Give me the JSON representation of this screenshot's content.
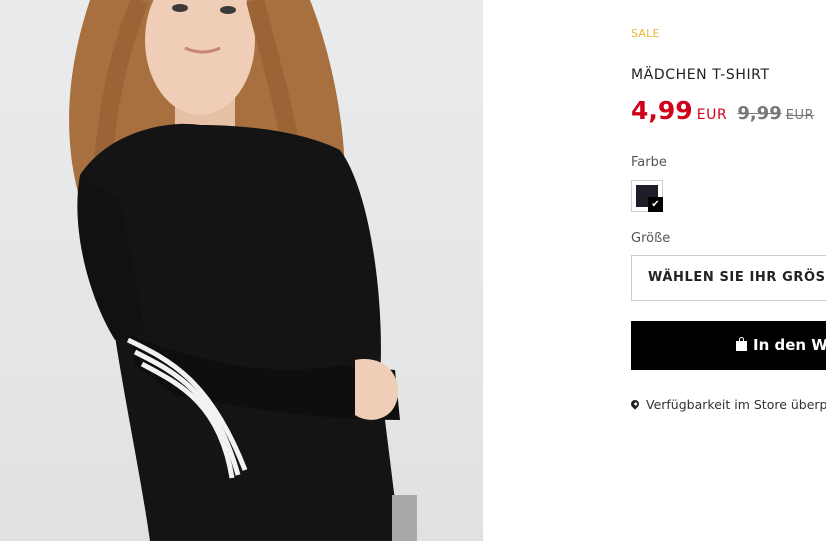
{
  "product": {
    "badge": "SALE",
    "title": "MÄDCHEN T-SHIRT",
    "price": {
      "current": "4,99",
      "current_currency": "EUR",
      "old": "9,99",
      "old_currency": "EUR",
      "sale_color": "#d0021b"
    },
    "image_icon": "product-photo"
  },
  "color": {
    "label": "Farbe",
    "selected_swatch": "#1e1e2a",
    "check_glyph": "✔"
  },
  "size": {
    "label": "Größe",
    "select_text": "WÄHLEN SIE IHR GRÖSSE"
  },
  "cart": {
    "button_label": "In den Warenkorb",
    "icon": "shopping-bag-icon"
  },
  "store": {
    "link_text": "Verfügbarkeit im Store überprüfen",
    "icon": "map-pin-icon"
  }
}
